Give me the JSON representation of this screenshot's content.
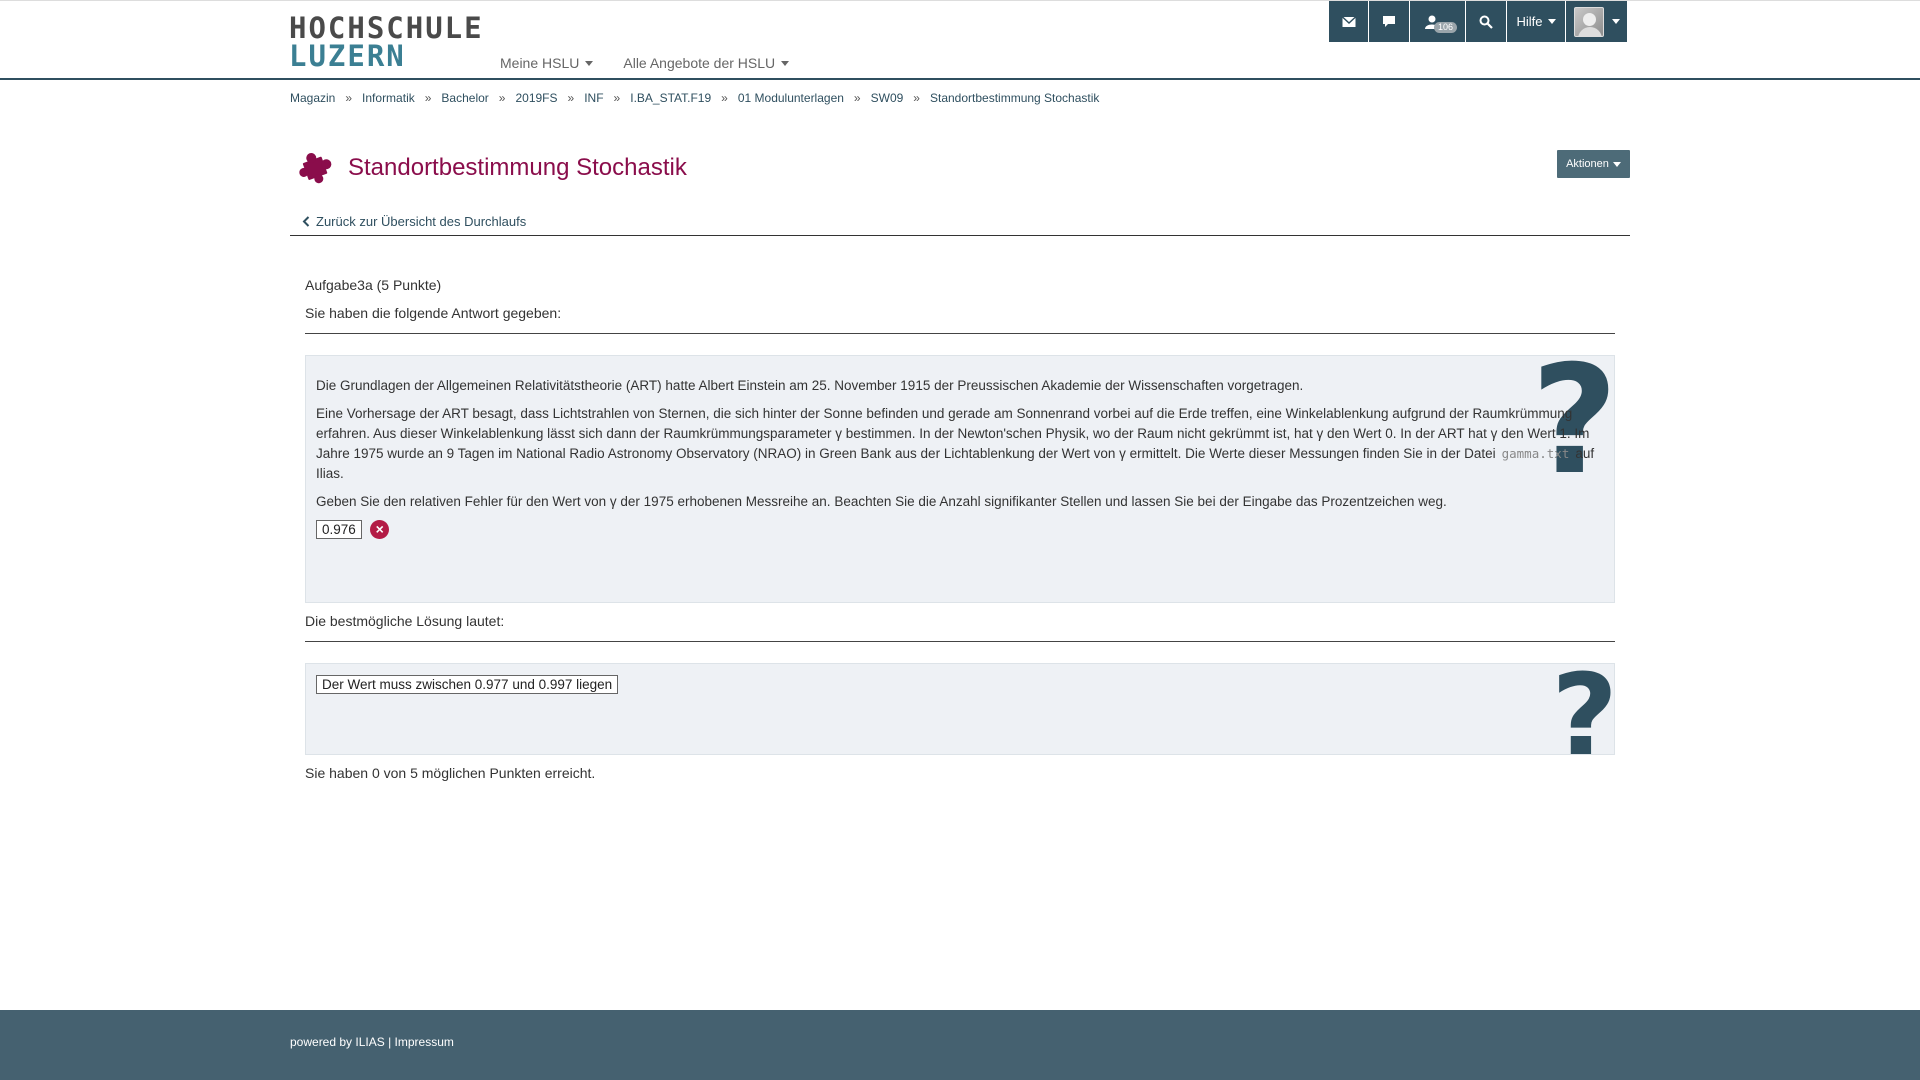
{
  "header": {
    "logo_line1": "HOCHSCHULE",
    "logo_line2": "LUZERN",
    "nav": [
      {
        "label": "Meine HSLU"
      },
      {
        "label": "Alle Angebote der HSLU"
      }
    ],
    "topbar": {
      "mail_icon": "envelope-icon",
      "chat_icon": "speech-bubble-icon",
      "user_icon": "user-icon",
      "user_badge": "106",
      "search_icon": "search-icon",
      "help_label": "Hilfe"
    }
  },
  "breadcrumb": [
    "Magazin",
    "Informatik",
    "Bachelor",
    "2019FS",
    "INF",
    "I.BA_STAT.F19",
    "01 Modulunterlagen",
    "SW09",
    "Standortbestimmung Stochastik"
  ],
  "breadcrumb_sep": "»",
  "page": {
    "title": "Standortbestimmung Stochastik",
    "actions_label": "Aktionen",
    "back_label": "Zurück zur Übersicht des Durchlaufs"
  },
  "question": {
    "task_title": "Aufgabe3a (5 Punkte)",
    "given_answer_label": "Sie haben die folgende Antwort gegeben:",
    "para1": "Die Grundlagen der Allgemeinen Relativitätstheorie (ART) hatte Albert Einstein am 25. November 1915 der Preussischen Akademie der Wissenschaften vorgetragen.",
    "para2_a": "Eine Vorhersage der ART besagt, dass Lichtstrahlen von Sternen, die sich hinter der Sonne befinden und gerade am Sonnenrand vorbei auf die Erde treffen, eine Winkelablenkung aufgrund der Raumkrümmung erfahren. Aus dieser Winkelablenkung lässt sich dann der Raumkrümmungsparameter γ bestimmen. In der Newton'schen Physik, wo der Raum nicht gekrümmt ist, hat γ den Wert 0. In der ART hat γ den Wert 1. Im Jahre 1975 wurde an 9 Tagen im National Radio Astronomy Observatory (NRAO) in Green Bank aus der Lichtablenkung der Wert von γ ermittelt. Die Werte dieser Messungen finden Sie in der Datei",
    "para2_code": "gamma.txt",
    "para2_b": "auf Ilias.",
    "para3": "Geben Sie den relativen Fehler für den Wert von γ der 1975 erhobenen Messreihe an. Beachten Sie die Anzahl signifikanter Stellen und lassen Sie bei der Eingabe das Prozentzeichen weg.",
    "answer_value": "0.976",
    "answer_status_icon": "wrong-x-icon",
    "question_icon": "?",
    "best_solution_label": "Die bestmögliche Lösung lautet:",
    "best_solution_value": "Der Wert muss zwischen 0.977 und 0.997 liegen",
    "score_text": "Sie haben 0 von 5 möglichen Punkten erreicht."
  },
  "footer": {
    "powered": "powered by ILIAS",
    "separator": "|",
    "impressum": "Impressum"
  },
  "colors": {
    "brand_dark": "#2f4f5f",
    "title_magenta": "#8a0d4b",
    "footer": "#456170",
    "box_bg": "#eef1f5"
  }
}
